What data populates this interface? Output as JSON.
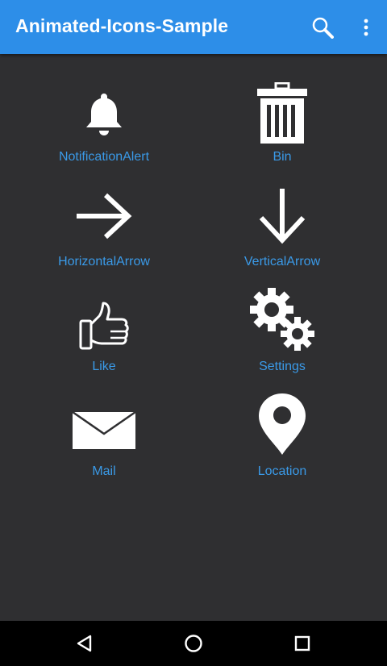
{
  "app_bar": {
    "title": "Animated-Icons-Sample",
    "background_color": "#2d8ee8",
    "actions": [
      {
        "icon": "search-icon"
      },
      {
        "icon": "more-vertical-icon"
      }
    ]
  },
  "content": {
    "background_color": "#2f2f31",
    "label_color": "#3a9ae8",
    "icon_color": "#ffffff",
    "items": [
      {
        "label": "NotificationAlert",
        "icon": "bell-icon"
      },
      {
        "label": "Bin",
        "icon": "trash-bin-icon"
      },
      {
        "label": "HorizontalArrow",
        "icon": "arrow-right-icon"
      },
      {
        "label": "VerticalArrow",
        "icon": "arrow-down-icon"
      },
      {
        "label": "Like",
        "icon": "thumbs-up-icon"
      },
      {
        "label": "Settings",
        "icon": "gears-icon"
      },
      {
        "label": "Mail",
        "icon": "mail-envelope-icon"
      },
      {
        "label": "Location",
        "icon": "map-pin-icon"
      }
    ]
  },
  "nav_bar": {
    "buttons": [
      {
        "icon": "back-triangle-icon"
      },
      {
        "icon": "home-circle-icon"
      },
      {
        "icon": "recents-square-icon"
      }
    ]
  }
}
